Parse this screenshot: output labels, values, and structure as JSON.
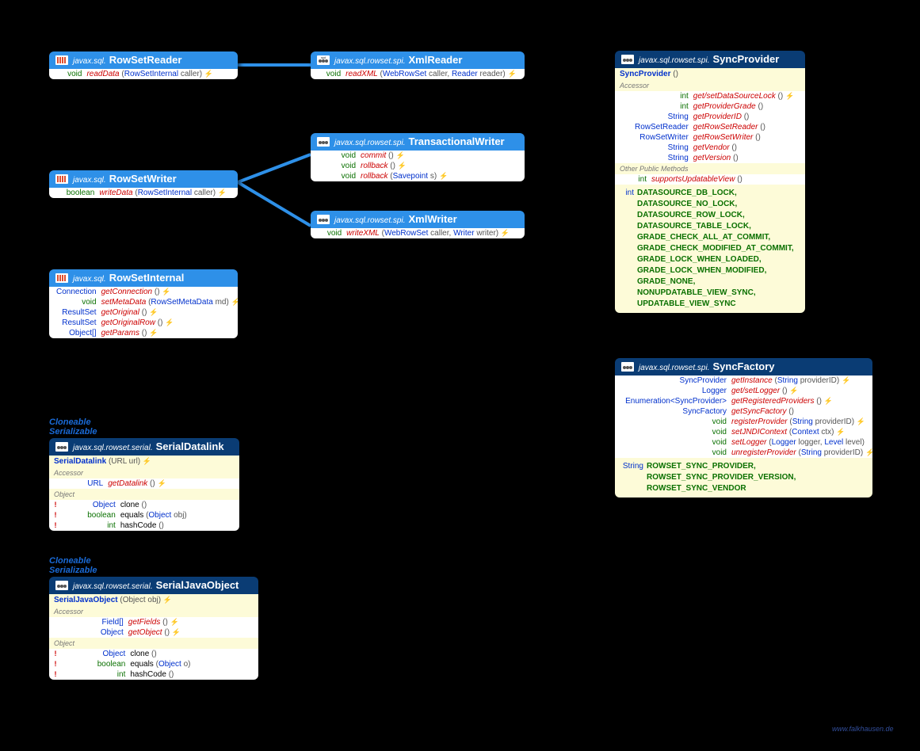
{
  "footer": "www.falkhausen.de",
  "super1": "Cloneable\nSerializable",
  "super2": "Cloneable\nSerializable",
  "icons": {
    "iface": "iface",
    "class": "class",
    "spi": "spi"
  },
  "rowSetReader": {
    "pkg": "javax.sql.",
    "cls": "RowSetReader",
    "m": [
      {
        "ret": "void",
        "name": "readData",
        "params": "(RowSetInternal caller)",
        "exc": "⚡"
      }
    ]
  },
  "xmlReader": {
    "pkg": "javax.sql.rowset.spi.",
    "cls": "XmlReader",
    "m": [
      {
        "ret": "void",
        "name": "readXML",
        "params": "(WebRowSet caller, Reader reader)",
        "exc": "⚡"
      }
    ]
  },
  "rowSetWriter": {
    "pkg": "javax.sql.",
    "cls": "RowSetWriter",
    "m": [
      {
        "ret": "boolean",
        "retprim": true,
        "name": "writeData",
        "params": "(RowSetInternal caller)",
        "exc": "⚡"
      }
    ]
  },
  "transactionalWriter": {
    "pkg": "javax.sql.rowset.spi.",
    "cls": "TransactionalWriter",
    "m": [
      {
        "ret": "void",
        "name": "commit",
        "params": "()",
        "exc": "⚡"
      },
      {
        "ret": "void",
        "name": "rollback",
        "params": "()",
        "exc": "⚡"
      },
      {
        "ret": "void",
        "name": "rollback",
        "params": "(Savepoint s)",
        "exc": "⚡"
      }
    ]
  },
  "xmlWriter": {
    "pkg": "javax.sql.rowset.spi.",
    "cls": "XmlWriter",
    "m": [
      {
        "ret": "void",
        "name": "writeXML",
        "params": "(WebRowSet caller, Writer writer)",
        "exc": "⚡"
      }
    ]
  },
  "rowSetInternal": {
    "pkg": "javax.sql.",
    "cls": "RowSetInternal",
    "m": [
      {
        "ret": "Connection",
        "name": "getConnection",
        "params": "()",
        "exc": "⚡"
      },
      {
        "ret": "void",
        "name": "setMetaData",
        "params": "(RowSetMetaData md)",
        "exc": "⚡"
      },
      {
        "ret": "ResultSet",
        "name": "getOriginal",
        "params": "()",
        "exc": "⚡"
      },
      {
        "ret": "ResultSet",
        "name": "getOriginalRow",
        "params": "()",
        "exc": "⚡"
      },
      {
        "ret": "Object[]",
        "name": "getParams",
        "params": "()",
        "exc": "⚡"
      }
    ]
  },
  "syncProvider": {
    "pkg": "javax.sql.rowset.spi.",
    "cls": "SyncProvider",
    "ctor": {
      "name": "SyncProvider",
      "params": "()"
    },
    "accSect": "Accessor",
    "otherSect": "Other Public Methods",
    "acc": [
      {
        "ret": "int",
        "retprim": true,
        "name": "get/setDataSourceLock",
        "params": "()",
        "exc": "⚡"
      },
      {
        "ret": "int",
        "retprim": true,
        "name": "getProviderGrade",
        "params": "()"
      },
      {
        "ret": "String",
        "name": "getProviderID",
        "params": "()"
      },
      {
        "ret": "RowSetReader",
        "name": "getRowSetReader",
        "params": "()"
      },
      {
        "ret": "RowSetWriter",
        "name": "getRowSetWriter",
        "params": "()"
      },
      {
        "ret": "String",
        "name": "getVendor",
        "params": "()"
      },
      {
        "ret": "String",
        "name": "getVersion",
        "params": "()"
      }
    ],
    "other": [
      {
        "ret": "int",
        "retprim": true,
        "name": "supportsUpdatableView",
        "params": "()"
      }
    ],
    "constType": "int",
    "constants": "DATASOURCE_DB_LOCK,\nDATASOURCE_NO_LOCK,\nDATASOURCE_ROW_LOCK,\nDATASOURCE_TABLE_LOCK,\nGRADE_CHECK_ALL_AT_COMMIT,\nGRADE_CHECK_MODIFIED_AT_COMMIT,\nGRADE_LOCK_WHEN_LOADED,\nGRADE_LOCK_WHEN_MODIFIED,\nGRADE_NONE,\nNONUPDATABLE_VIEW_SYNC,\nUPDATABLE_VIEW_SYNC"
  },
  "syncFactory": {
    "pkg": "javax.sql.rowset.spi.",
    "cls": "SyncFactory",
    "m": [
      {
        "ret": "SyncProvider",
        "name": "getInstance",
        "params": "(String providerID)",
        "exc": "⚡"
      },
      {
        "ret": "Logger",
        "name": "get/setLogger",
        "params": "()",
        "exc": "⚡"
      },
      {
        "ret": "Enumeration<SyncProvider>",
        "name": "getRegisteredProviders",
        "params": "()",
        "exc": "⚡"
      },
      {
        "ret": "SyncFactory",
        "name": "getSyncFactory",
        "params": "()"
      },
      {
        "ret": "void",
        "name": "registerProvider",
        "params": "(String providerID)",
        "exc": "⚡"
      },
      {
        "ret": "void",
        "name": "setJNDIContext",
        "params": "(Context ctx)",
        "exc": "⚡"
      },
      {
        "ret": "void",
        "name": "setLogger",
        "params": "(Logger logger, Level level)"
      },
      {
        "ret": "void",
        "name": "unregisterProvider",
        "params": "(String providerID)",
        "exc": "⚡"
      }
    ],
    "constType": "String",
    "constants": "ROWSET_SYNC_PROVIDER,\nROWSET_SYNC_PROVIDER_VERSION,\nROWSET_SYNC_VENDOR"
  },
  "serialDatalink": {
    "pkg": "javax.sql.rowset.serial.",
    "cls": "SerialDatalink",
    "ctor": {
      "name": "SerialDatalink",
      "params": "(URL url)",
      "exc": "⚡"
    },
    "accSect": "Accessor",
    "objSect": "Object",
    "acc": [
      {
        "ret": "URL",
        "name": "getDatalink",
        "params": "()",
        "exc": "⚡"
      }
    ],
    "obj": [
      {
        "mark": "!",
        "ret": "Object",
        "name": "clone",
        "params": "()",
        "black": true
      },
      {
        "mark": "!",
        "ret": "boolean",
        "retprim": true,
        "name": "equals",
        "params": "(Object obj)",
        "black": true
      },
      {
        "mark": "!",
        "ret": "int",
        "retprim": true,
        "name": "hashCode",
        "params": "()",
        "black": true
      }
    ]
  },
  "serialJavaObject": {
    "pkg": "javax.sql.rowset.serial.",
    "cls": "SerialJavaObject",
    "ctor": {
      "name": "SerialJavaObject",
      "params": "(Object obj)",
      "exc": "⚡"
    },
    "accSect": "Accessor",
    "objSect": "Object",
    "acc": [
      {
        "ret": "Field[]",
        "name": "getFields",
        "params": "()",
        "exc": "⚡"
      },
      {
        "ret": "Object",
        "name": "getObject",
        "params": "()",
        "exc": "⚡"
      }
    ],
    "obj": [
      {
        "mark": "!",
        "ret": "Object",
        "name": "clone",
        "params": "()",
        "black": true
      },
      {
        "mark": "!",
        "ret": "boolean",
        "retprim": true,
        "name": "equals",
        "params": "(Object o)",
        "black": true
      },
      {
        "mark": "!",
        "ret": "int",
        "retprim": true,
        "name": "hashCode",
        "params": "()",
        "black": true
      }
    ]
  }
}
